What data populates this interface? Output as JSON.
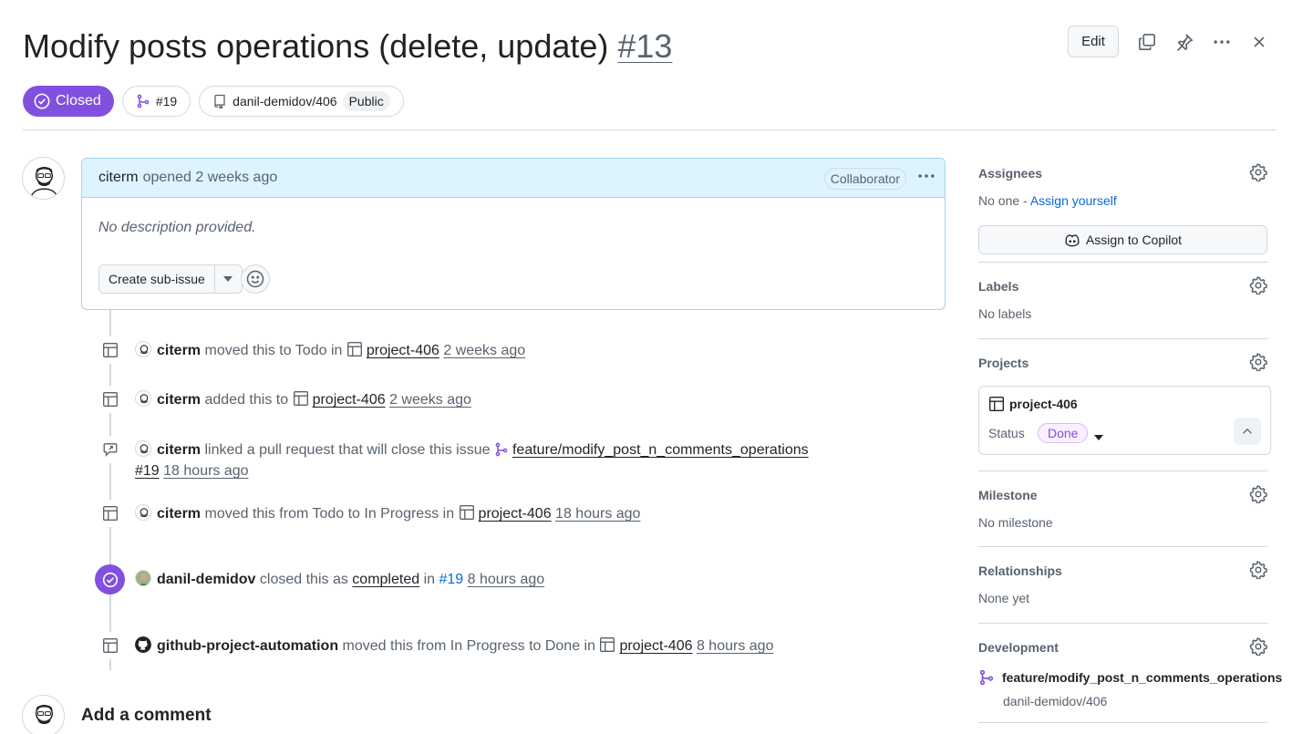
{
  "header": {
    "title": "Modify posts operations (delete, update)",
    "number": "#13",
    "edit_label": "Edit",
    "state": "Closed",
    "linked_pr": "#19",
    "repo": "danil-demidov/406",
    "visibility": "Public"
  },
  "comment": {
    "author": "citerm",
    "action": "opened 2 weeks ago",
    "role": "Collaborator",
    "body": "No description provided.",
    "create_sub_issue": "Create sub-issue"
  },
  "timeline": [
    {
      "who": "citerm",
      "text1": "moved this to Todo in",
      "project": "project-406",
      "time": "2 weeks ago"
    },
    {
      "who": "citerm",
      "text1": "added this to",
      "project": "project-406",
      "time": "2 weeks ago"
    },
    {
      "who": "citerm",
      "text1": "linked a pull request that will close this issue",
      "branch": "feature/modify_post_n_comments_operations",
      "pr": "#19",
      "time": "18 hours ago"
    },
    {
      "who": "citerm",
      "text1": "moved this from Todo to In Progress in",
      "project": "project-406",
      "time": "18 hours ago"
    },
    {
      "who": "danil-demidov",
      "text1": "closed this as",
      "status": "completed",
      "text2": "in",
      "pr": "#19",
      "time": "8 hours ago"
    },
    {
      "who": "github-project-automation",
      "text1": "moved this from In Progress to Done in",
      "project": "project-406",
      "time": "8 hours ago"
    }
  ],
  "add_comment": "Add a comment",
  "sidebar": {
    "assignees": {
      "title": "Assignees",
      "none": "No one -",
      "assign_self": "Assign yourself",
      "copilot": "Assign to Copilot"
    },
    "labels": {
      "title": "Labels",
      "value": "No labels"
    },
    "projects": {
      "title": "Projects",
      "name": "project-406",
      "status_label": "Status",
      "status": "Done"
    },
    "milestone": {
      "title": "Milestone",
      "value": "No milestone"
    },
    "relationships": {
      "title": "Relationships",
      "value": "None yet"
    },
    "development": {
      "title": "Development",
      "branch": "feature/modify_post_n_comments_operations",
      "repo": "danil-demidov/406"
    }
  },
  "colors": {
    "closed": "#8250df",
    "link": "#0969da",
    "comment_head": "#ddf4ff"
  }
}
